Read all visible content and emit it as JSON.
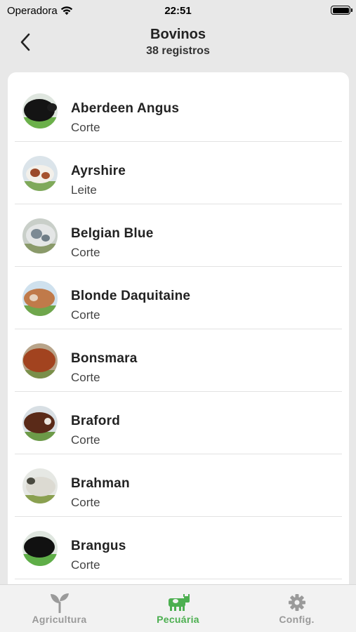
{
  "status_bar": {
    "carrier": "Operadora",
    "time": "22:51",
    "wifi_icon": "wifi-icon",
    "battery_level": 1.0
  },
  "nav": {
    "back_icon": "chevron-left-icon",
    "title": "Bovinos",
    "subtitle": "38 registros"
  },
  "breeds": [
    {
      "name": "Aberdeen Angus",
      "type": "Corte",
      "photo": "black-cattle"
    },
    {
      "name": "Ayrshire",
      "type": "Leite",
      "photo": "red-white-cattle"
    },
    {
      "name": "Belgian Blue",
      "type": "Corte",
      "photo": "blue-roan-cattle"
    },
    {
      "name": "Blonde Daquitaine",
      "type": "Corte",
      "photo": "blonde-cattle"
    },
    {
      "name": "Bonsmara",
      "type": "Corte",
      "photo": "red-cattle"
    },
    {
      "name": "Braford",
      "type": "Corte",
      "photo": "brown-white-face-cattle"
    },
    {
      "name": "Brahman",
      "type": "Corte",
      "photo": "white-zebu-cattle"
    },
    {
      "name": "Brangus",
      "type": "Corte",
      "photo": "black-cattle"
    }
  ],
  "tabs": [
    {
      "label": "Agricultura",
      "icon": "plant-sprout-icon",
      "active": false
    },
    {
      "label": "Pecuária",
      "icon": "cow-icon",
      "active": true
    },
    {
      "label": "Config.",
      "icon": "gear-icon",
      "active": false
    }
  ],
  "colors": {
    "accent": "#4caf50",
    "inactive": "#9a9a9a",
    "background": "#e8e8e8"
  }
}
